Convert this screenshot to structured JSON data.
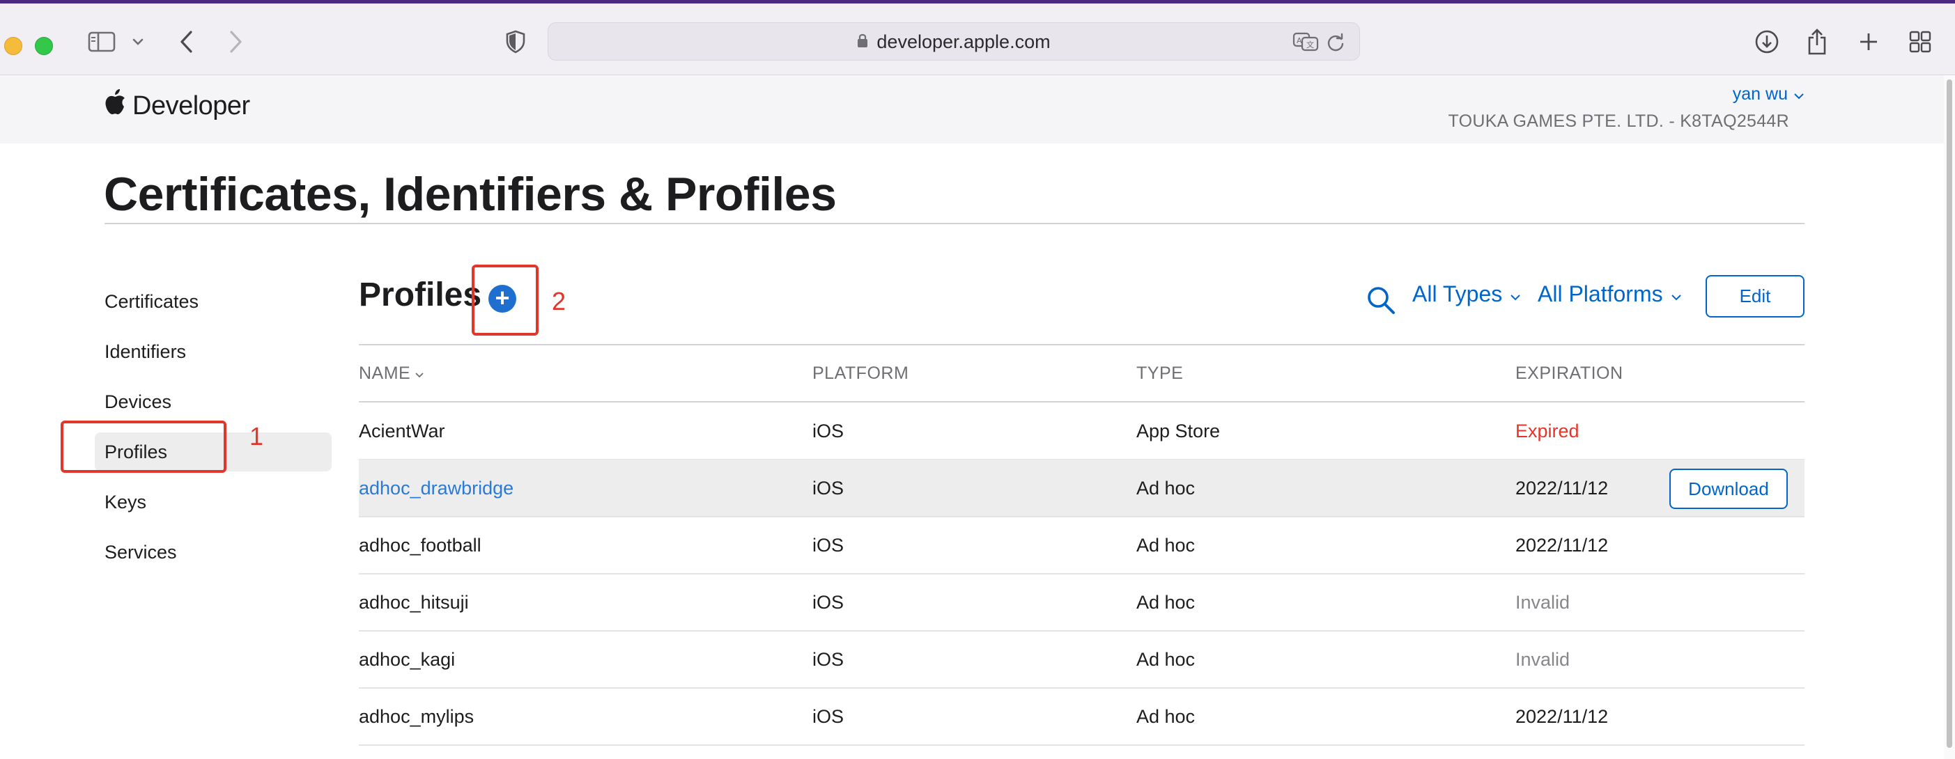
{
  "browser": {
    "url": "developer.apple.com"
  },
  "header": {
    "brand": "Developer",
    "user_name": "yan wu",
    "team": "TOUKA GAMES PTE. LTD. - K8TAQ2544R"
  },
  "page_title": "Certificates, Identifiers & Profiles",
  "sidebar": {
    "items": [
      {
        "label": "Certificates"
      },
      {
        "label": "Identifiers"
      },
      {
        "label": "Devices"
      },
      {
        "label": "Profiles"
      },
      {
        "label": "Keys"
      },
      {
        "label": "Services"
      }
    ],
    "active": "Profiles"
  },
  "section": {
    "title": "Profiles",
    "filter_types": "All Types",
    "filter_platforms": "All Platforms",
    "edit_label": "Edit"
  },
  "annotations": {
    "sidebar_marker": "1",
    "add_marker": "2",
    "color": "#e3362b"
  },
  "table": {
    "headers": {
      "name": "NAME",
      "platform": "PLATFORM",
      "type": "TYPE",
      "expiration": "EXPIRATION"
    },
    "rows": [
      {
        "name": "AcientWar",
        "platform": "iOS",
        "type": "App Store",
        "expiration": "Expired"
      },
      {
        "name": "adhoc_drawbridge",
        "platform": "iOS",
        "type": "Ad hoc",
        "expiration": "2022/11/12",
        "action": "Download"
      },
      {
        "name": "adhoc_football",
        "platform": "iOS",
        "type": "Ad hoc",
        "expiration": "2022/11/12"
      },
      {
        "name": "adhoc_hitsuji",
        "platform": "iOS",
        "type": "Ad hoc",
        "expiration": "Invalid"
      },
      {
        "name": "adhoc_kagi",
        "platform": "iOS",
        "type": "Ad hoc",
        "expiration": "Invalid"
      },
      {
        "name": "adhoc_mylips",
        "platform": "iOS",
        "type": "Ad hoc",
        "expiration": "2022/11/12"
      }
    ]
  },
  "colors": {
    "link": "#0066cc",
    "expired": "#e3362b",
    "invalid": "#86868b"
  }
}
